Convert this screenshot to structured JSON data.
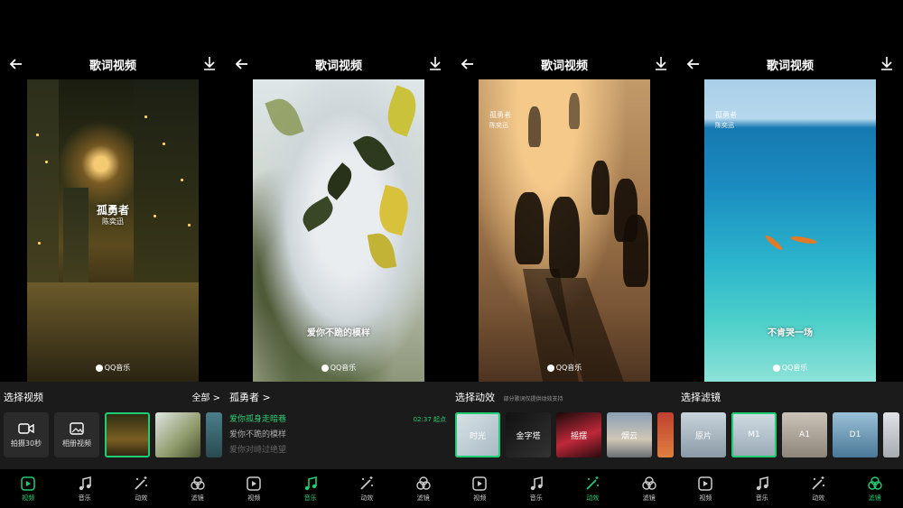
{
  "accent": "#1fce72",
  "screens": [
    {
      "title": "歌词视频",
      "overlay_main": "孤勇者",
      "overlay_sub": "陈奕迅",
      "watermark": "QQ音乐",
      "panel_title": "选择视频",
      "panel_right": "全部 >",
      "thumbs": [
        {
          "label": "拍摄30秒",
          "icon": "camera-icon"
        },
        {
          "label": "相册视频",
          "icon": "image-icon"
        }
      ]
    },
    {
      "title": "歌词视频",
      "overlay_main": "爱你不跪的模样",
      "watermark": "QQ音乐",
      "panel_title": "孤勇者 >",
      "lyrics": [
        "爱你孤身走暗巷",
        "爱你不跪的模样",
        "爱你对峙过绝望"
      ],
      "lyric_meta": "02:37 起点"
    },
    {
      "title": "歌词视频",
      "overlay_small_1": "孤勇者",
      "overlay_small_2": "陈奕迅",
      "watermark": "QQ音乐",
      "panel_title": "选择动效",
      "panel_hint": "部分歌词仅提供动效支持",
      "effects": [
        "时光",
        "金字塔",
        "摇摆",
        "烟云"
      ]
    },
    {
      "title": "歌词视频",
      "overlay_small_1": "孤勇者",
      "overlay_small_2": "陈奕迅",
      "overlay_main": "不肯哭一场",
      "watermark": "QQ音乐",
      "panel_title": "选择滤镜",
      "filters": [
        "原片",
        "M1",
        "A1",
        "D1"
      ]
    }
  ],
  "tabs": [
    "视频",
    "音乐",
    "动效",
    "滤镜"
  ]
}
